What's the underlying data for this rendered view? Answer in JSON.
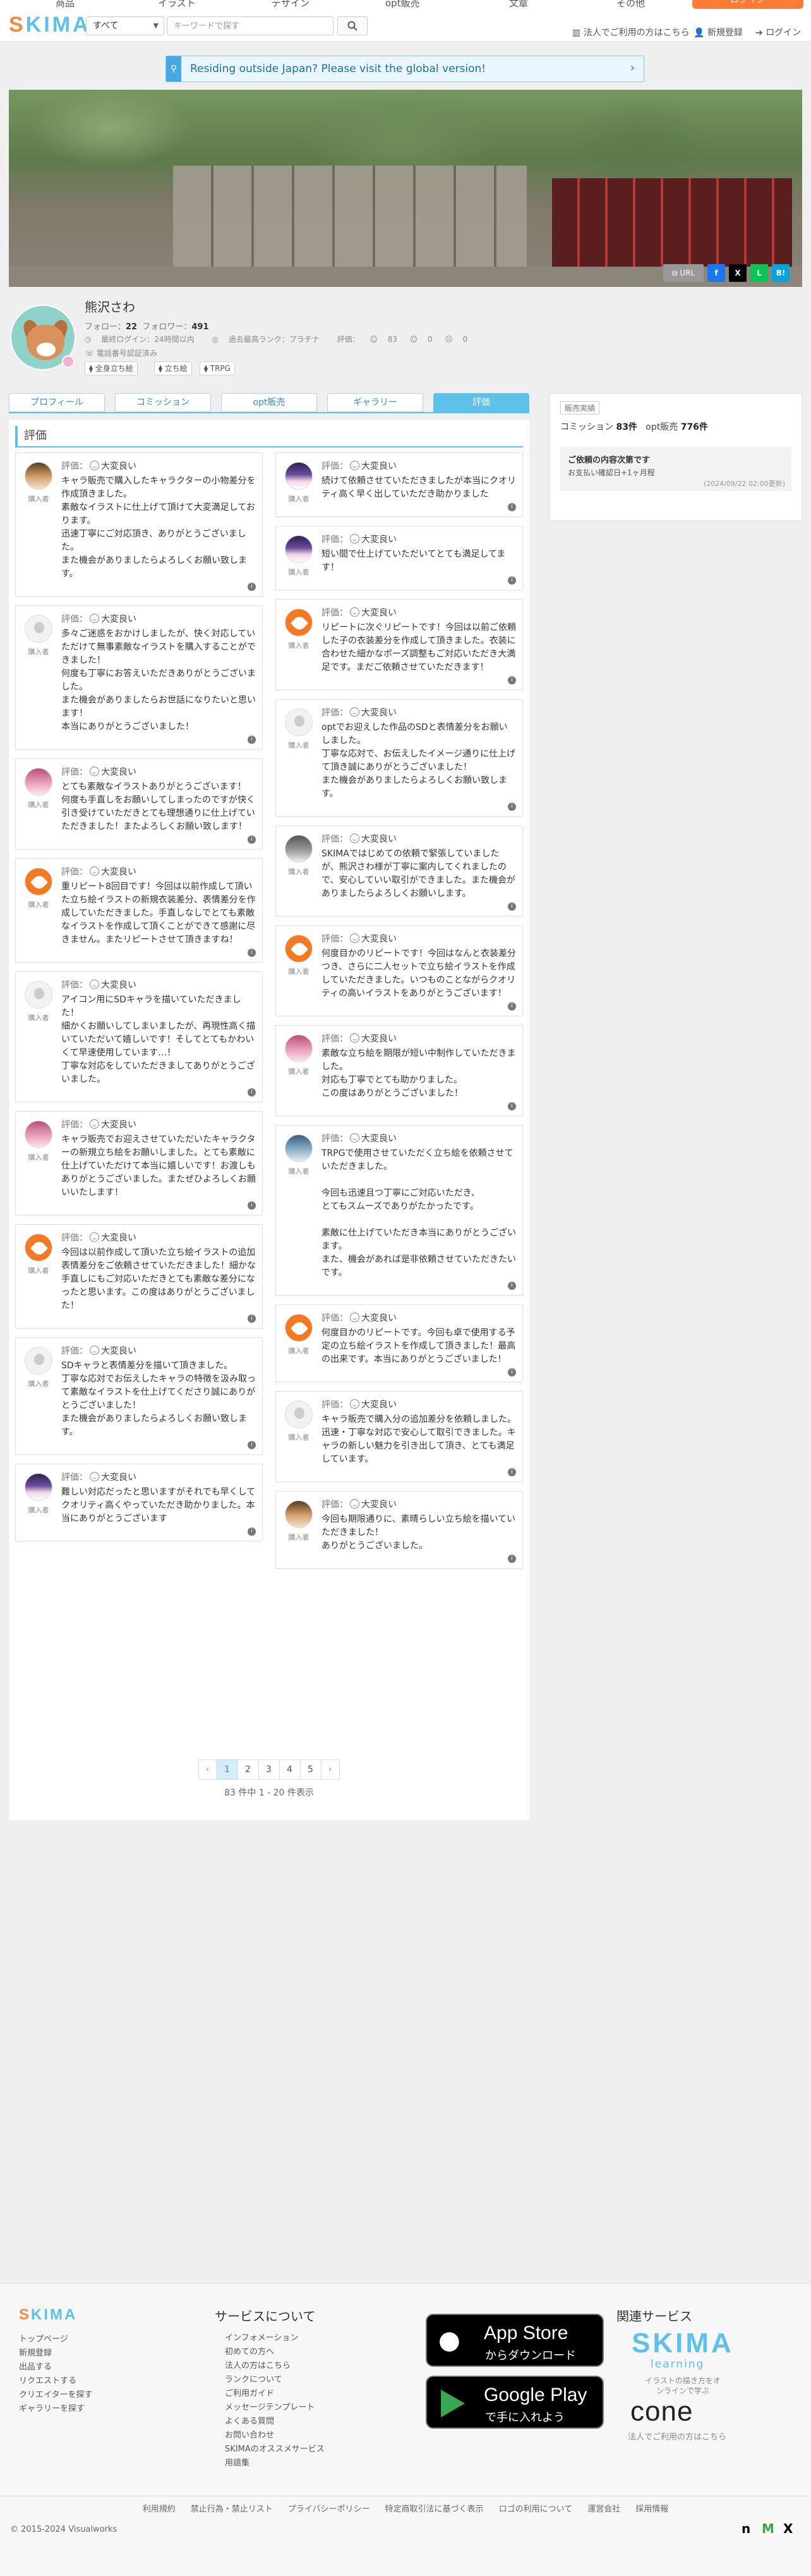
{
  "topnav": {
    "items": [
      "商品",
      "イラスト",
      "デザイン",
      "opt販売",
      "文章",
      "その他"
    ],
    "login": "ログイン"
  },
  "header": {
    "logo": "SKIMA",
    "category": "すべて",
    "search_placeholder": "キーワードで探す",
    "corp_link": "法人でご利用の方はこちら",
    "signup": "新規登録",
    "login": "ログイン"
  },
  "notice": {
    "text": "Residing outside Japan? Please visit the global version!"
  },
  "share": {
    "url": "URL",
    "facebook": "f",
    "x": "X",
    "line": "L",
    "hatena": "B!"
  },
  "profile": {
    "name": "熊沢さわ",
    "follow_label": "フォロー：",
    "follow_count": "22",
    "follower_label": "フォロワー：",
    "follower_count": "491",
    "last_login": "最終ログイン：24時間以内",
    "rank": "過去最高ランク：プラチナ",
    "rating_label": "評価：",
    "rating_good": "83",
    "rating_normal": "0",
    "rating_bad": "0",
    "phone": "電話番号認証済み",
    "tags": [
      "全身立ち絵",
      "立ち絵",
      "TRPG"
    ]
  },
  "tabs": [
    "プロフィール",
    "コミッション",
    "opt販売",
    "ギャラリー",
    "評価"
  ],
  "reviews_title": "評価",
  "rating_prefix": "評価：",
  "buyer_label": "購入者",
  "reviews_left": [
    {
      "verdict": "大変良い",
      "avatar": "brown",
      "text": "キャラ販売で購入したキャラクターの小物差分を作成頂きました。\n素敵なイラストに仕上げて頂けて大変満足しております。\n迅速丁寧にご対応頂き、ありがとうございました。\nまた機会がありましたらよろしくお願い致します。"
    },
    {
      "verdict": "大変良い",
      "avatar": "default",
      "text": "多々ご迷惑をおかけしましたが、快く対応していただけて無事素敵なイラストを購入することができました！\n何度も丁寧にお答えいただきありがとうございました。\nまた機会がありましたらお世話になりたいと思います！\n本当にありがとうございました！"
    },
    {
      "verdict": "大変良い",
      "avatar": "pink",
      "text": "とても素敵なイラストありがとうございます！\n何度も手直しをお願いしてしまったのですが快く引き受けていただきとても理想通りに仕上げていただきました！またよろしくお願い致します！"
    },
    {
      "verdict": "大変良い",
      "avatar": "orange",
      "text": "重リピート8回目です！今回は以前作成して頂いた立ち絵イラストの新規衣装差分、表情差分を作成していただきました。手直しなしでとても素敵なイラストを作成して頂くことができて感謝に尽きません。またリピートさせて頂きますね！"
    },
    {
      "verdict": "大変良い",
      "avatar": "default",
      "text": "アイコン用にSDキャラを描いていただきました！\n細かくお願いしてしまいましたが、再現性高く描いていただいて嬉しいです！そしてとてもかわいくて早速使用しています…！\n丁寧な対応をしていただきましてありがとうございました。"
    },
    {
      "verdict": "大変良い",
      "avatar": "pink",
      "text": "キャラ販売でお迎えさせていただいたキャラクターの新規立ち絵をお願いしました。とても素敵に仕上げていただけて本当に嬉しいです！お渡しもありがとうございました。またぜひよろしくお願いいたします！"
    },
    {
      "verdict": "大変良い",
      "avatar": "orange",
      "text": "今回は以前作成して頂いた立ち絵イラストの追加表情差分をご依頼させていただきました！細かな手直しにもご対応いただきとても素敵な差分になったと思います。この度はありがとうございました！"
    },
    {
      "verdict": "大変良い",
      "avatar": "default",
      "text": "SDキャラと表情差分を描いて頂きました。\n丁寧な応対でお伝えしたキャラの特徴を汲み取って素敵なイラストを仕上げてくださり誠にありがとうございました！\nまた機会がありましたらよろしくお願い致します。"
    },
    {
      "verdict": "大変良い",
      "avatar": "char",
      "text": "難しい対応だったと思いますがそれでも早くしてクオリティ高くやっていただき助かりました。本当にありがとうございます"
    }
  ],
  "reviews_right": [
    {
      "verdict": "大変良い",
      "avatar": "char",
      "text": "続けて依頼させていただきましたが本当にクオリティ高く早く出していただき助かりました"
    },
    {
      "verdict": "大変良い",
      "avatar": "char",
      "text": "短い間で仕上げていただいてとても満足してます！"
    },
    {
      "verdict": "大変良い",
      "avatar": "orange",
      "text": "リピートに次ぐリピートです！今回は以前ご依頼した子の衣装差分を作成して頂きました。衣装に合わせた細かなポーズ調整もご対応いただき大満足です。まだご依頼させていただきます！"
    },
    {
      "verdict": "大変良い",
      "avatar": "default",
      "text": "optでお迎えした作品のSDと表情差分をお願いしました。\n丁寧な応対で、お伝えしたイメージ通りに仕上げて頂き誠にありがとうございました！\nまた機会がありましたらよろしくお願い致します。"
    },
    {
      "verdict": "大変良い",
      "avatar": "gray",
      "text": "SKIMAではじめての依頼で緊張していましたが、熊沢さわ様が丁寧に案内してくれましたので、安心していい取引ができました。また機会がありましたらよろしくお願いします。"
    },
    {
      "verdict": "大変良い",
      "avatar": "orange",
      "text": "何度目かのリピートです！今回はなんと衣装差分つき、さらに二人セットで立ち絵イラストを作成していただきました。いつものことながらクオリティの高いイラストをありがとうございます！"
    },
    {
      "verdict": "大変良い",
      "avatar": "pink",
      "text": "素敵な立ち絵を期限が短い中制作していただきました。\n対応も丁寧でとても助かりました。\nこの度はありがとうございました！"
    },
    {
      "verdict": "大変良い",
      "avatar": "blue",
      "text": "TRPGで使用させていただく立ち絵を依頼させていただきました。\n\n今回も迅速且つ丁寧にご対応いただき、\nとてもスムーズでありがたかったです。\n\n素敵に仕上げていただき本当にありがとうございます。\nまた、機会があれば是非依頼させていただきたいです。"
    },
    {
      "verdict": "大変良い",
      "avatar": "orange",
      "text": "何度目かのリピートです。今回も卓で使用する予定の立ち絵イラストを作成して頂きました！最高の出来です。本当にありがとうございました！"
    },
    {
      "verdict": "大変良い",
      "avatar": "default",
      "text": "キャラ販売で購入分の追加差分を依頼しました。迅速・丁寧な対応で安心して取引できました。キャラの新しい魅力を引き出して頂き、とても満足しています。"
    },
    {
      "verdict": "大変良い",
      "avatar": "brown",
      "text": "今回も期限通りに、素晴らしい立ち絵を描いていただきました！\nありがとうございました。"
    }
  ],
  "pagination": {
    "prev": "‹",
    "pages": [
      "1",
      "2",
      "3",
      "4",
      "5"
    ],
    "next": "›",
    "summary": "83 件中 1 - 20 件表示"
  },
  "sidebar": {
    "label": "販売実績",
    "commission_label": "コミッション",
    "commission_count": "83件",
    "opt_label": "opt販売",
    "opt_count": "776件",
    "box_title": "ご依頼の内容次第です",
    "box_sub": "お支払い確認日+1ヶ月程",
    "box_date": "(2024/09/22 02:00更新)"
  },
  "footer": {
    "logo": "SKIMA",
    "left_links": [
      "トップページ",
      "新規登録",
      "出品する",
      "リクエストする",
      "クリエイターを探す",
      "ギャラリーを探す"
    ],
    "service_head": "サービスについて",
    "service_links": [
      "インフォメーション",
      "初めての方へ",
      "法人の方はこちら",
      "ランクについて",
      "ご利用ガイド",
      "メッセージテンプレート",
      "よくある質問",
      "お問い合わせ",
      "SKIMAのオススメサービス",
      "用語集"
    ],
    "appstore_big": "App Store",
    "appstore_small": "からダウンロード",
    "googleplay_big": "Google Play",
    "googleplay_small": "で手に入れよう",
    "related_head": "関連サービス",
    "learning_logo": "SKIMA",
    "learning_sub": "learning",
    "learning_caption": "イラストの描き方をオンラインで学ぶ",
    "cone_logo": "cone",
    "cone_caption": "法人でご利用の方はこちら",
    "bottom_links": [
      "利用規約",
      "禁止行為・禁止リスト",
      "プライバシーポリシー",
      "特定商取引法に基づく表示",
      "ロゴの利用について",
      "運営会社",
      "採用情報"
    ],
    "copyright": "© 2015-2024 Visualworks"
  }
}
